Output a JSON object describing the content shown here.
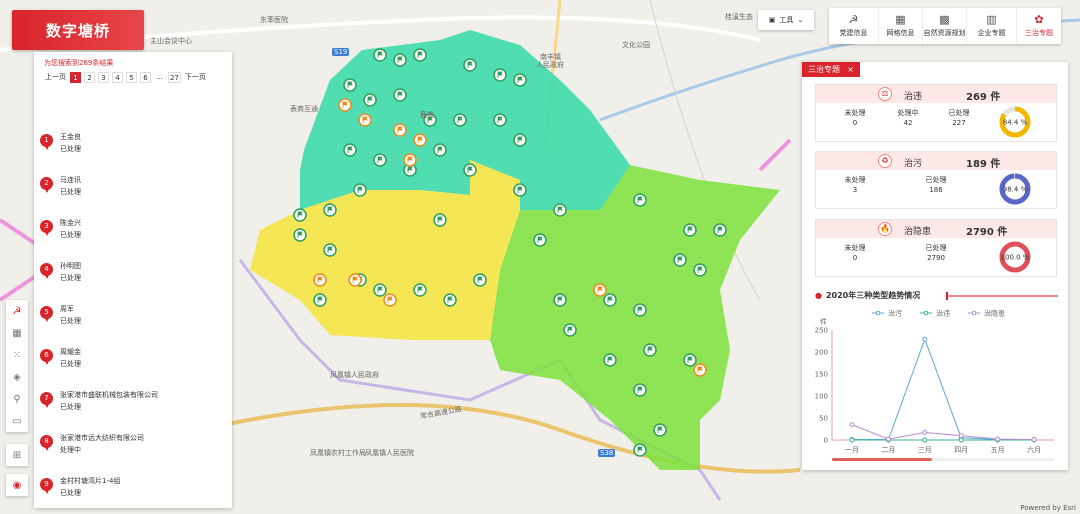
{
  "app": {
    "logo": "数字塘桥",
    "attribution": "Powered by Esri"
  },
  "map_labels": [
    "东苯医院",
    "主山会议中心",
    "桂溪生态",
    "人民政府",
    "文化公园",
    "表商互通",
    "鹿苑",
    "南丰镇",
    "凤凰镇人民政府",
    "凤凰镇农村工作局",
    "凤凰镇人民医院",
    "常合高速公路",
    "S19",
    "S38",
    "农村工作局"
  ],
  "results": {
    "summary": "为您搜索到269条结果",
    "pager": {
      "prev": "上一页",
      "next": "下一页",
      "pages": [
        "1",
        "2",
        "3",
        "4",
        "5",
        "6",
        "...",
        "27"
      ],
      "current": "1"
    },
    "items": [
      {
        "no": "1",
        "name": "王金良",
        "status": "已处理"
      },
      {
        "no": "2",
        "name": "马连讯",
        "status": "已处理"
      },
      {
        "no": "3",
        "name": "陈金兴",
        "status": "已处理"
      },
      {
        "no": "4",
        "name": "孙明图",
        "status": "已处理"
      },
      {
        "no": "5",
        "name": "周军",
        "status": "已处理"
      },
      {
        "no": "6",
        "name": "周耀金",
        "status": "已处理"
      },
      {
        "no": "7",
        "name": "张家港市盛联机械包装有限公司",
        "status": "已处理"
      },
      {
        "no": "8",
        "name": "张家港市远大纺织有限公司",
        "status": "处理中"
      },
      {
        "no": "9",
        "name": "金村村塘湾片1-4组",
        "status": "已处理"
      }
    ]
  },
  "toolbar": {
    "tools_label": "工具",
    "nav": [
      {
        "label": "党建信息",
        "icon": "party-icon"
      },
      {
        "label": "网格信息",
        "icon": "grid-icon"
      },
      {
        "label": "自然资源规划",
        "icon": "resources-icon"
      },
      {
        "label": "企业专题",
        "icon": "enterprise-icon"
      },
      {
        "label": "三治专题",
        "icon": "three-governance-icon"
      }
    ]
  },
  "stats_panel": {
    "tab_label": "三治专题",
    "close": "×",
    "cards": [
      {
        "icon": "violation-icon",
        "icon_glyph": "⚖",
        "name": "治违",
        "total": "269 件",
        "subs": [
          {
            "label": "未处理",
            "value": "0"
          },
          {
            "label": "处理中",
            "value": "42"
          },
          {
            "label": "已处理",
            "value": "227"
          }
        ],
        "ring_label": "84.4 %",
        "ring_fraction": 0.844,
        "ring_color": "#f2b800"
      },
      {
        "icon": "pollution-icon",
        "icon_glyph": "♻",
        "name": "治污",
        "total": "189 件",
        "subs": [
          {
            "label": "未处理",
            "value": "3"
          },
          {
            "label": "已处理",
            "value": "186"
          }
        ],
        "ring_label": "98.4 %",
        "ring_fraction": 0.984,
        "ring_color": "#5b67c7"
      },
      {
        "icon": "hazard-icon",
        "icon_glyph": "🔥",
        "name": "治隐患",
        "total": "2790 件",
        "subs": [
          {
            "label": "未处理",
            "value": "0"
          },
          {
            "label": "已处理",
            "value": "2790"
          }
        ],
        "ring_label": "100.0 %",
        "ring_fraction": 1.0,
        "ring_color": "#e0505a"
      }
    ],
    "chart_title": "2020年三种类型趋势情况"
  },
  "chart_data": {
    "type": "line",
    "title": "2020年三种类型趋势情况",
    "ylabel": "件",
    "categories": [
      "一月",
      "二月",
      "三月",
      "四月",
      "五月",
      "六月"
    ],
    "ylim": [
      0,
      250
    ],
    "yticks": [
      0,
      50,
      100,
      150,
      200,
      250
    ],
    "grid": false,
    "legend": "top",
    "series": [
      {
        "name": "治污",
        "color": "#5aa9d6",
        "values": [
          1,
          1,
          229,
          5,
          1,
          1
        ]
      },
      {
        "name": "治违",
        "color": "#3ab39a",
        "values": [
          0,
          0,
          0,
          0,
          0,
          0
        ]
      },
      {
        "name": "治隐患",
        "color": "#b58bd1",
        "values": [
          35,
          2,
          17,
          10,
          2,
          1
        ]
      }
    ]
  },
  "colors": {
    "brand_red": "#d9242b",
    "zone_cyan": "#34d9a8",
    "zone_yellow": "#f5e43a",
    "zone_green": "#7ee23c",
    "zone_pink": "#e86fd8"
  }
}
